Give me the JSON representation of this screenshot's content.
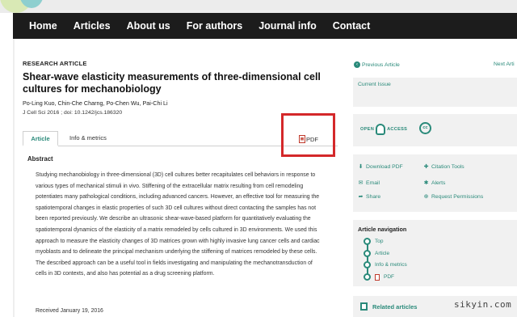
{
  "nav": {
    "items": [
      "Home",
      "Articles",
      "About us",
      "For authors",
      "Journal info",
      "Contact"
    ]
  },
  "article": {
    "kicker": "RESEARCH ARTICLE",
    "title": "Shear-wave elasticity measurements of three-dimensional cell cultures for mechanobiology",
    "authors": "Po-Ling Kuo, Chin-Che Charng, Po-Chen Wu, Pai-Chi Li",
    "citation": "J Cell Sci 2016 ; doi: 10.1242/jcs.186320",
    "tabs": [
      "Article",
      "Info & metrics"
    ],
    "pdf_label": "PDF",
    "abstract_heading": "Abstract",
    "abstract": "Studying mechanobiology in three-dimensional (3D) cell cultures better recapitulates cell behaviors in response to various types of mechanical stimuli in vivo. Stiffening of the extracellular matrix resulting from cell remodeling potentiates many pathological conditions, including advanced cancers. However, an effective tool for measuring the spatiotemporal changes in elastic properties of such 3D cell cultures without direct contacting the samples has not been reported previously. We describe an ultrasonic shear-wave-based platform for quantitatively evaluating the spatiotemporal dynamics of the elasticity of a matrix remodeled by cells cultured in 3D environments. We used this approach to measure the elasticity changes of 3D matrices grown with highly invasive lung cancer cells and cardiac myoblasts and to delineate the principal mechanism underlying the stiffening of matrices remodeled by these cells. The described approach can be a useful tool in fields investigating and manipulating the mechanotransduction of cells in 3D contexts, and also has potential as a drug screening platform.",
    "received": "Received January 19, 2016"
  },
  "sidebar": {
    "prev": "Previous Article",
    "next": "Next Arti",
    "current_issue": "Current Issue",
    "open_access": {
      "left": "OPEN",
      "right": "ACCESS"
    },
    "cc": "cc",
    "tools": [
      {
        "label": "Download PDF",
        "icon": "download-icon"
      },
      {
        "label": "Citation Tools",
        "icon": "citation-icon"
      },
      {
        "label": "Email",
        "icon": "email-icon"
      },
      {
        "label": "Alerts",
        "icon": "alerts-icon"
      },
      {
        "label": "Share",
        "icon": "share-icon"
      },
      {
        "label": "Request Permissions",
        "icon": "permissions-icon"
      }
    ],
    "article_nav": {
      "title": "Article navigation",
      "items": [
        "Top",
        "Article",
        "Info & metrics",
        "PDF"
      ]
    },
    "related": "Related articles"
  },
  "watermark": "sikyin.com",
  "colors": {
    "accent": "#2a8a7a",
    "navbar": "#1c1c1c",
    "highlight": "#d4282a"
  }
}
